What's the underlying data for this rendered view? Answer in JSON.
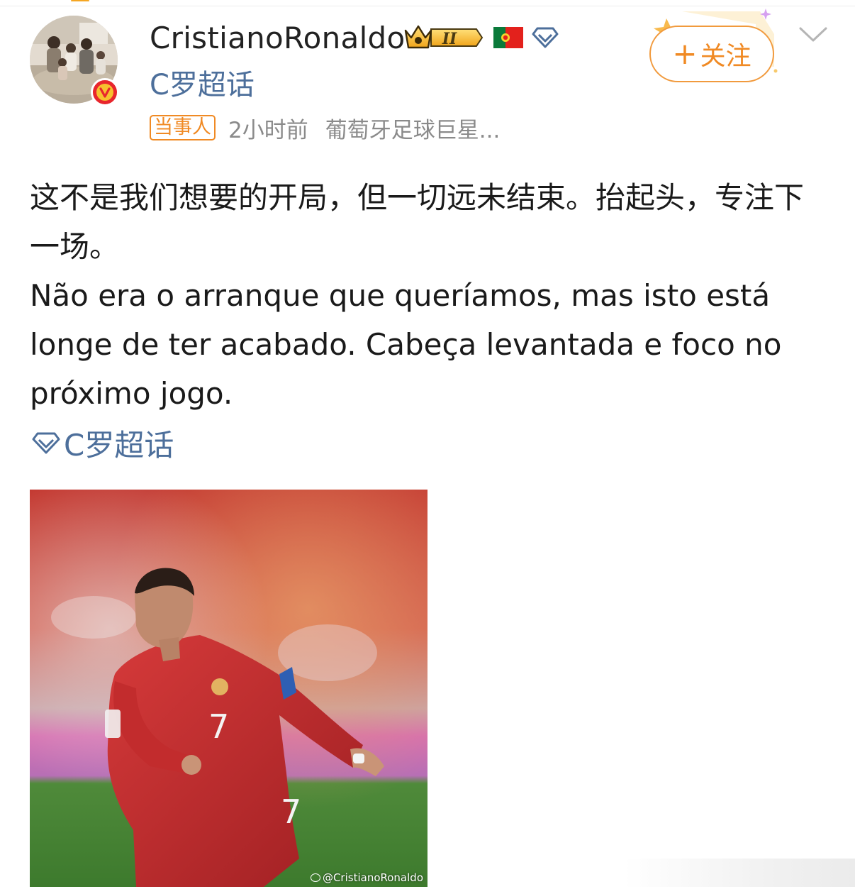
{
  "post": {
    "author": {
      "name": "CristianoRonaldo",
      "level_badge": "II",
      "verified": true
    },
    "supertopic_name": "C罗超话",
    "meta": {
      "tag": "当事人",
      "time": "2小时前",
      "source": "葡萄牙足球巨星..."
    },
    "text": {
      "chinese": "这不是我们想要的开局，但一切远未结束。抬起头，专注下一场。",
      "portuguese": "Não era o arranque que queríamos, mas isto está longe de ter acabado. Cabeça levantada e foco no próximo jogo."
    },
    "hashtag": "C罗超话",
    "image": {
      "watermark": "@CristianoRonaldo",
      "jersey_number": "7"
    }
  },
  "actions": {
    "follow_plus": "+",
    "follow_label": "关注"
  },
  "colors": {
    "link": "#4d6f9b",
    "follow_orange": "#f08a24",
    "verified_red": "#e8262d",
    "meta_gray": "#8a8a8a"
  },
  "icons": [
    "verified-v-icon",
    "crown-icon",
    "portugal-flag-icon",
    "diamond-icon",
    "chevron-down-icon"
  ]
}
